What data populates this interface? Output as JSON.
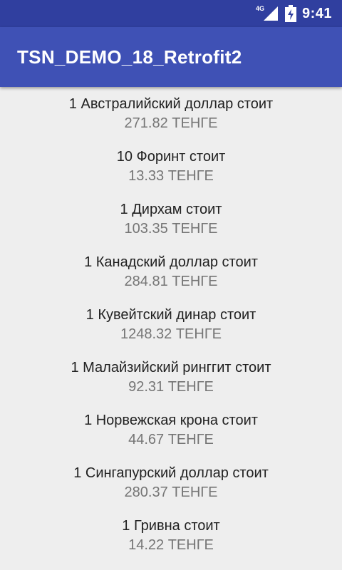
{
  "status_bar": {
    "network": "4G",
    "time": "9:41"
  },
  "app_bar": {
    "title": "TSN_DEMO_18_Retrofit2"
  },
  "rates": [
    {
      "title": "1 Австралийский доллар стоит",
      "value": "271.82 ТЕНГЕ"
    },
    {
      "title": "10 Форинт стоит",
      "value": "13.33 ТЕНГЕ"
    },
    {
      "title": "1 Дирхам стоит",
      "value": "103.35 ТЕНГЕ"
    },
    {
      "title": "1 Канадский доллар стоит",
      "value": "284.81 ТЕНГЕ"
    },
    {
      "title": "1 Кувейтский динар стоит",
      "value": "1248.32 ТЕНГЕ"
    },
    {
      "title": "1 Малайзийский ринггит стоит",
      "value": "92.31 ТЕНГЕ"
    },
    {
      "title": "1 Норвежская крона стоит",
      "value": "44.67 ТЕНГЕ"
    },
    {
      "title": "1 Сингапурский доллар стоит",
      "value": "280.37 ТЕНГЕ"
    },
    {
      "title": "1 Гривна стоит",
      "value": "14.22 ТЕНГЕ"
    }
  ],
  "colors": {
    "status_bar": "#303f9f",
    "app_bar": "#3f51b5",
    "background": "#eeeeee",
    "title_text": "#212121",
    "value_text": "#757575"
  },
  "icons": [
    "signal-icon",
    "battery-charging-icon"
  ]
}
